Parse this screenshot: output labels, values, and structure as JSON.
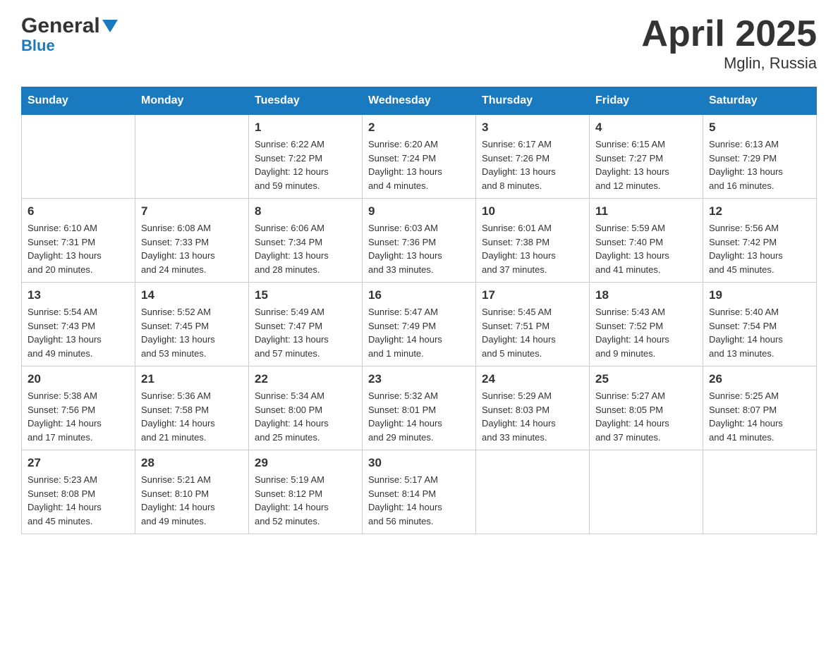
{
  "header": {
    "logo": {
      "general": "General",
      "blue": "Blue"
    },
    "title": "April 2025",
    "subtitle": "Mglin, Russia"
  },
  "weekdays": [
    "Sunday",
    "Monday",
    "Tuesday",
    "Wednesday",
    "Thursday",
    "Friday",
    "Saturday"
  ],
  "weeks": [
    [
      {
        "day": "",
        "info": ""
      },
      {
        "day": "",
        "info": ""
      },
      {
        "day": "1",
        "info": "Sunrise: 6:22 AM\nSunset: 7:22 PM\nDaylight: 12 hours\nand 59 minutes."
      },
      {
        "day": "2",
        "info": "Sunrise: 6:20 AM\nSunset: 7:24 PM\nDaylight: 13 hours\nand 4 minutes."
      },
      {
        "day": "3",
        "info": "Sunrise: 6:17 AM\nSunset: 7:26 PM\nDaylight: 13 hours\nand 8 minutes."
      },
      {
        "day": "4",
        "info": "Sunrise: 6:15 AM\nSunset: 7:27 PM\nDaylight: 13 hours\nand 12 minutes."
      },
      {
        "day": "5",
        "info": "Sunrise: 6:13 AM\nSunset: 7:29 PM\nDaylight: 13 hours\nand 16 minutes."
      }
    ],
    [
      {
        "day": "6",
        "info": "Sunrise: 6:10 AM\nSunset: 7:31 PM\nDaylight: 13 hours\nand 20 minutes."
      },
      {
        "day": "7",
        "info": "Sunrise: 6:08 AM\nSunset: 7:33 PM\nDaylight: 13 hours\nand 24 minutes."
      },
      {
        "day": "8",
        "info": "Sunrise: 6:06 AM\nSunset: 7:34 PM\nDaylight: 13 hours\nand 28 minutes."
      },
      {
        "day": "9",
        "info": "Sunrise: 6:03 AM\nSunset: 7:36 PM\nDaylight: 13 hours\nand 33 minutes."
      },
      {
        "day": "10",
        "info": "Sunrise: 6:01 AM\nSunset: 7:38 PM\nDaylight: 13 hours\nand 37 minutes."
      },
      {
        "day": "11",
        "info": "Sunrise: 5:59 AM\nSunset: 7:40 PM\nDaylight: 13 hours\nand 41 minutes."
      },
      {
        "day": "12",
        "info": "Sunrise: 5:56 AM\nSunset: 7:42 PM\nDaylight: 13 hours\nand 45 minutes."
      }
    ],
    [
      {
        "day": "13",
        "info": "Sunrise: 5:54 AM\nSunset: 7:43 PM\nDaylight: 13 hours\nand 49 minutes."
      },
      {
        "day": "14",
        "info": "Sunrise: 5:52 AM\nSunset: 7:45 PM\nDaylight: 13 hours\nand 53 minutes."
      },
      {
        "day": "15",
        "info": "Sunrise: 5:49 AM\nSunset: 7:47 PM\nDaylight: 13 hours\nand 57 minutes."
      },
      {
        "day": "16",
        "info": "Sunrise: 5:47 AM\nSunset: 7:49 PM\nDaylight: 14 hours\nand 1 minute."
      },
      {
        "day": "17",
        "info": "Sunrise: 5:45 AM\nSunset: 7:51 PM\nDaylight: 14 hours\nand 5 minutes."
      },
      {
        "day": "18",
        "info": "Sunrise: 5:43 AM\nSunset: 7:52 PM\nDaylight: 14 hours\nand 9 minutes."
      },
      {
        "day": "19",
        "info": "Sunrise: 5:40 AM\nSunset: 7:54 PM\nDaylight: 14 hours\nand 13 minutes."
      }
    ],
    [
      {
        "day": "20",
        "info": "Sunrise: 5:38 AM\nSunset: 7:56 PM\nDaylight: 14 hours\nand 17 minutes."
      },
      {
        "day": "21",
        "info": "Sunrise: 5:36 AM\nSunset: 7:58 PM\nDaylight: 14 hours\nand 21 minutes."
      },
      {
        "day": "22",
        "info": "Sunrise: 5:34 AM\nSunset: 8:00 PM\nDaylight: 14 hours\nand 25 minutes."
      },
      {
        "day": "23",
        "info": "Sunrise: 5:32 AM\nSunset: 8:01 PM\nDaylight: 14 hours\nand 29 minutes."
      },
      {
        "day": "24",
        "info": "Sunrise: 5:29 AM\nSunset: 8:03 PM\nDaylight: 14 hours\nand 33 minutes."
      },
      {
        "day": "25",
        "info": "Sunrise: 5:27 AM\nSunset: 8:05 PM\nDaylight: 14 hours\nand 37 minutes."
      },
      {
        "day": "26",
        "info": "Sunrise: 5:25 AM\nSunset: 8:07 PM\nDaylight: 14 hours\nand 41 minutes."
      }
    ],
    [
      {
        "day": "27",
        "info": "Sunrise: 5:23 AM\nSunset: 8:08 PM\nDaylight: 14 hours\nand 45 minutes."
      },
      {
        "day": "28",
        "info": "Sunrise: 5:21 AM\nSunset: 8:10 PM\nDaylight: 14 hours\nand 49 minutes."
      },
      {
        "day": "29",
        "info": "Sunrise: 5:19 AM\nSunset: 8:12 PM\nDaylight: 14 hours\nand 52 minutes."
      },
      {
        "day": "30",
        "info": "Sunrise: 5:17 AM\nSunset: 8:14 PM\nDaylight: 14 hours\nand 56 minutes."
      },
      {
        "day": "",
        "info": ""
      },
      {
        "day": "",
        "info": ""
      },
      {
        "day": "",
        "info": ""
      }
    ]
  ]
}
